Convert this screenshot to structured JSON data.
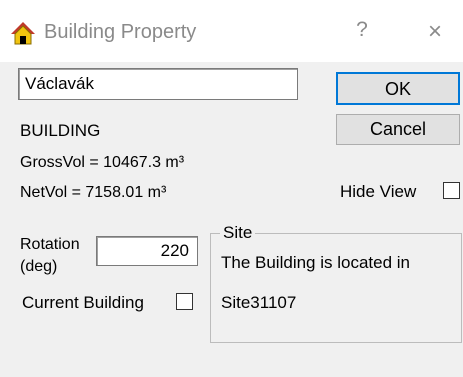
{
  "window": {
    "title": "Building Property",
    "help_glyph": "?",
    "close_glyph": "×",
    "icon": "house-icon"
  },
  "form": {
    "name_value": "Václavák",
    "type_label": "BUILDING",
    "gross_vol": "GrossVol = 10467.3 m³",
    "net_vol": "NetVol = 7158.01 m³",
    "rotation_label_1": "Rotation",
    "rotation_label_2": "(deg)",
    "rotation_value": "220",
    "current_building_label": "Current Building",
    "current_building_checked": false,
    "hide_view_label": "Hide View",
    "hide_view_checked": false
  },
  "buttons": {
    "ok": "OK",
    "cancel": "Cancel"
  },
  "site": {
    "group_title": "Site",
    "text": "The Building is located in",
    "site_name": "Site31107"
  },
  "colors": {
    "accent": "#0078d7",
    "icon_roof": "#c0392b",
    "icon_wall": "#f1c40f"
  }
}
